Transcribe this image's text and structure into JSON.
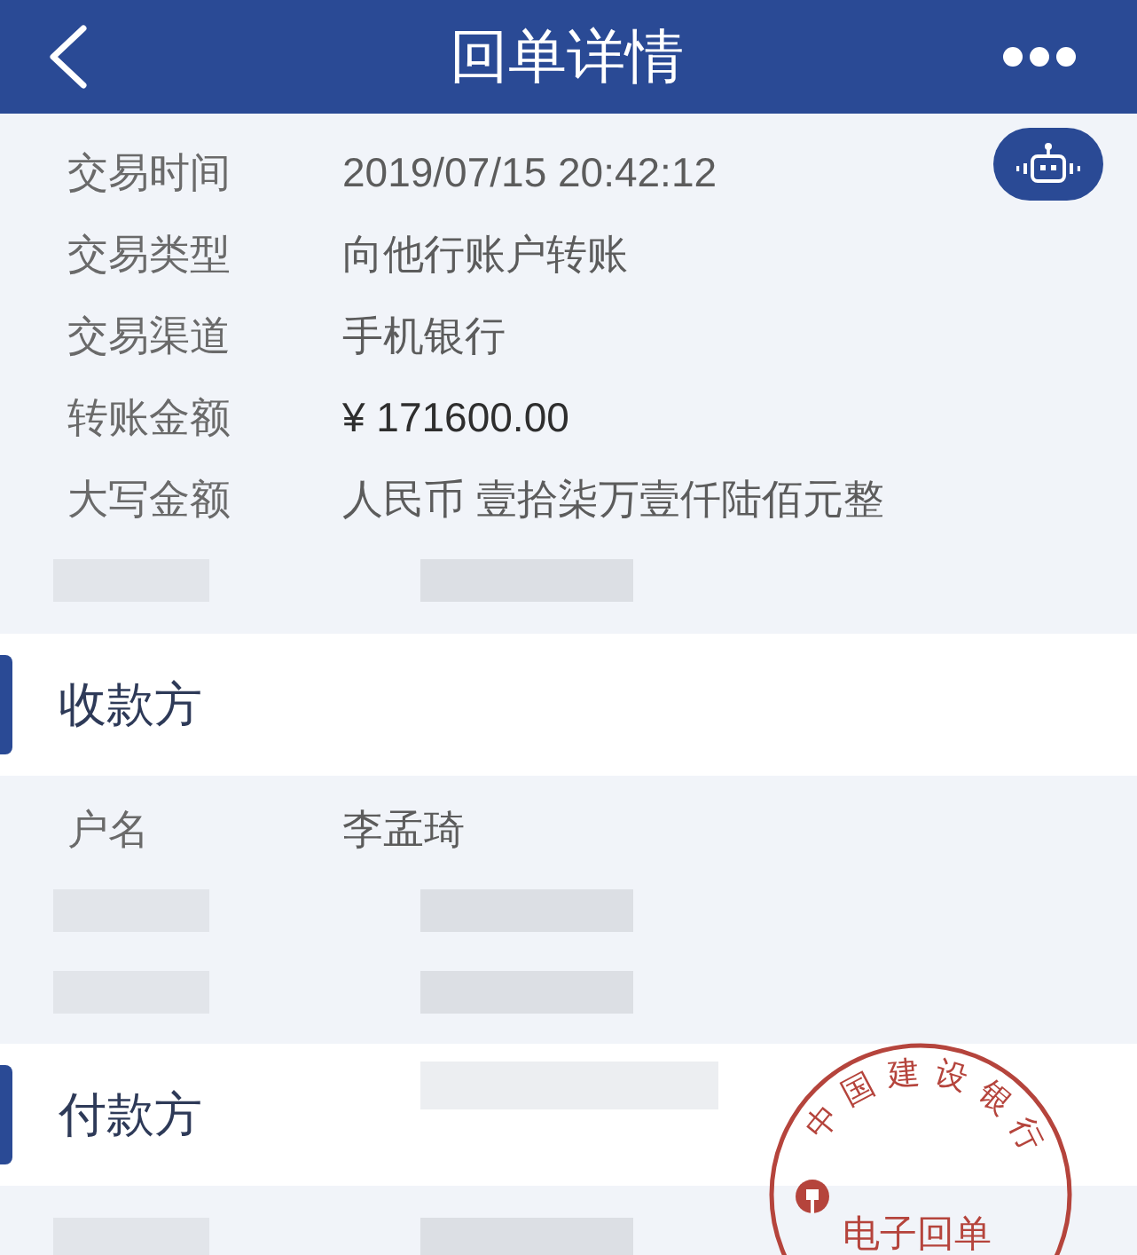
{
  "header": {
    "title": "回单详情"
  },
  "details": {
    "rows": [
      {
        "kind": "field",
        "label": "交易时间",
        "value": "2019/07/15 20:42:12"
      },
      {
        "kind": "field",
        "label": "交易类型",
        "value": "向他行账户转账"
      },
      {
        "kind": "field",
        "label": "交易渠道",
        "value": "手机银行"
      },
      {
        "kind": "amount",
        "label": "转账金额",
        "value": "¥ 171600.00"
      },
      {
        "kind": "field",
        "label": "大写金额",
        "value": "人民币 壹拾柒万壹仟陆佰元整"
      },
      {
        "kind": "redacted"
      }
    ]
  },
  "parties": [
    {
      "title": "收款方",
      "redacted": false,
      "rows": [
        {
          "kind": "field",
          "label": "户名",
          "value": "李孟琦"
        },
        {
          "kind": "redacted"
        },
        {
          "kind": "redacted"
        }
      ]
    },
    {
      "title": "付款方",
      "redacted": true,
      "rows": [
        {
          "kind": "redacted"
        }
      ]
    }
  ],
  "stamp": {
    "arc_text": "中国建设银行",
    "center_text": "电子回单"
  }
}
